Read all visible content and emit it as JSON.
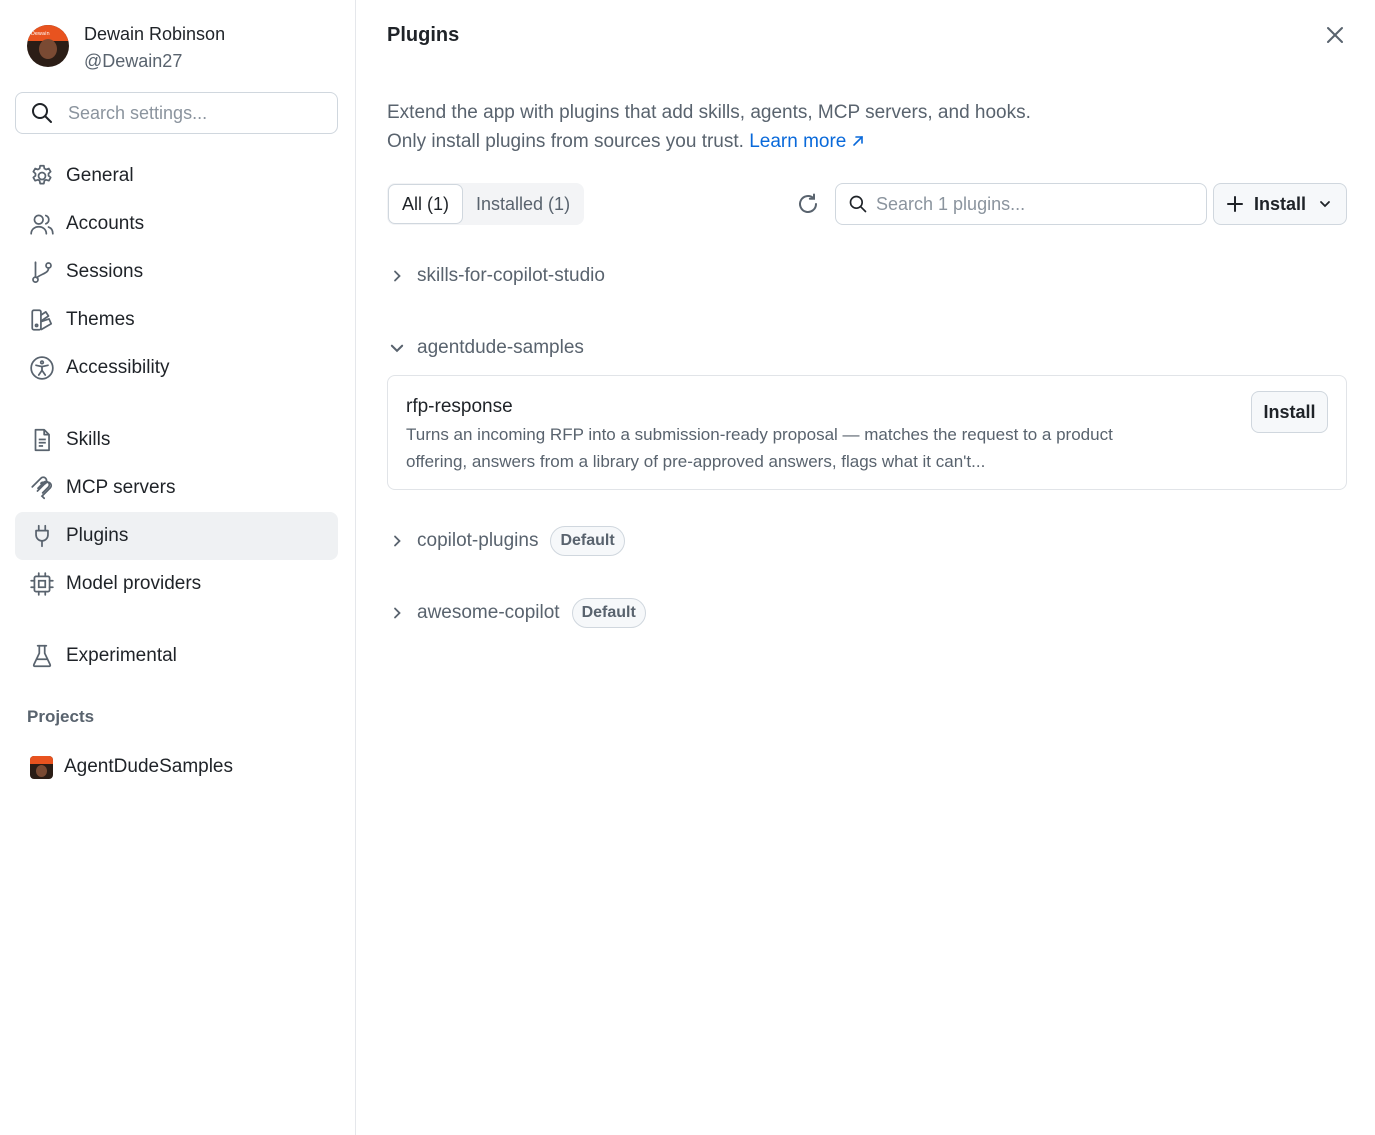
{
  "profile": {
    "name": "Dewain Robinson",
    "handle": "@Dewain27",
    "avatar_text": "Dewain"
  },
  "sidebar": {
    "search_placeholder": "Search settings...",
    "groups": [
      [
        {
          "label": "General",
          "icon": "gear-icon"
        },
        {
          "label": "Accounts",
          "icon": "users-icon"
        },
        {
          "label": "Sessions",
          "icon": "branch-icon"
        },
        {
          "label": "Themes",
          "icon": "palette-icon"
        },
        {
          "label": "Accessibility",
          "icon": "accessibility-icon"
        }
      ],
      [
        {
          "label": "Skills",
          "icon": "document-icon"
        },
        {
          "label": "MCP servers",
          "icon": "mcp-icon"
        },
        {
          "label": "Plugins",
          "icon": "plug-icon",
          "active": true
        },
        {
          "label": "Model providers",
          "icon": "chip-icon"
        }
      ],
      [
        {
          "label": "Experimental",
          "icon": "beaker-icon"
        }
      ]
    ],
    "projects_heading": "Projects",
    "projects": [
      {
        "label": "AgentDudeSamples"
      }
    ]
  },
  "main": {
    "title": "Plugins",
    "intro_line1": "Extend the app with plugins that add skills, agents, MCP servers, and hooks.",
    "intro_line2": "Only install plugins from sources you trust.",
    "learn_more": "Learn more",
    "tabs": [
      {
        "label": "All (1)",
        "active": true
      },
      {
        "label": "Installed (1)",
        "active": false
      }
    ],
    "search_placeholder": "Search 1 plugins...",
    "install_label": "Install",
    "groups": [
      {
        "name": "skills-for-copilot-studio",
        "expanded": false
      },
      {
        "name": "agentdude-samples",
        "expanded": true
      },
      {
        "name": "copilot-plugins",
        "expanded": false,
        "badge": "Default"
      },
      {
        "name": "awesome-copilot",
        "expanded": false,
        "badge": "Default"
      }
    ],
    "plugin": {
      "name": "rfp-response",
      "description": "Turns an incoming RFP into a submission-ready proposal — matches the request to a product offering, answers from a library of pre-approved answers, flags what it can't...",
      "install_label": "Install"
    }
  },
  "colors": {
    "link": "#0969da",
    "active_nav_bg": "#eff1f3",
    "avatar_accent": "#e8531f"
  }
}
